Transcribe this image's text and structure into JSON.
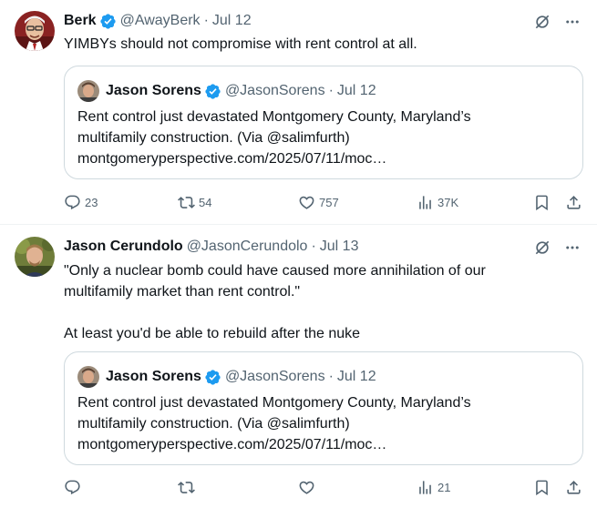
{
  "tweets": [
    {
      "author": {
        "name": "Berk",
        "handle": "@AwayBerk",
        "date": "Jul 12"
      },
      "text": "YIMBYs should not compromise with rent control at all.",
      "quote": {
        "name": "Jason Sorens",
        "handle": "@JasonSorens",
        "date": "Jul 12",
        "text_line1": "Rent control just devastated Montgomery County, Maryland’s",
        "text_line2": "multifamily construction. (Via @salimfurth)",
        "text_line3": "montgomeryperspective.com/2025/07/11/moc…"
      },
      "stats": {
        "replies": "23",
        "reposts": "54",
        "likes": "757",
        "views": "37K"
      }
    },
    {
      "author": {
        "name": "Jason Cerundolo",
        "handle": "@JasonCerundolo",
        "date": "Jul 13"
      },
      "text": "\"Only a nuclear bomb could have caused more annihilation of our\nmultifamily market than rent control.\"\n\nAt least you'd be able to rebuild after the nuke",
      "quote": {
        "name": "Jason Sorens",
        "handle": "@JasonSorens",
        "date": "Jul 12",
        "text_line1": "Rent control just devastated Montgomery County, Maryland’s",
        "text_line2": "multifamily construction. (Via @salimfurth)",
        "text_line3": "montgomeryperspective.com/2025/07/11/moc…"
      },
      "stats": {
        "replies": "",
        "reposts": "",
        "likes": "",
        "views": "21"
      }
    }
  ],
  "separator": "·",
  "colors": {
    "verified": "#1d9bf0",
    "muted": "#536471",
    "border": "#cfd9de"
  },
  "icons": [
    "verified-badge-icon",
    "grok-icon",
    "more-icon",
    "reply-icon",
    "repost-icon",
    "like-icon",
    "views-icon",
    "bookmark-icon",
    "share-icon"
  ]
}
